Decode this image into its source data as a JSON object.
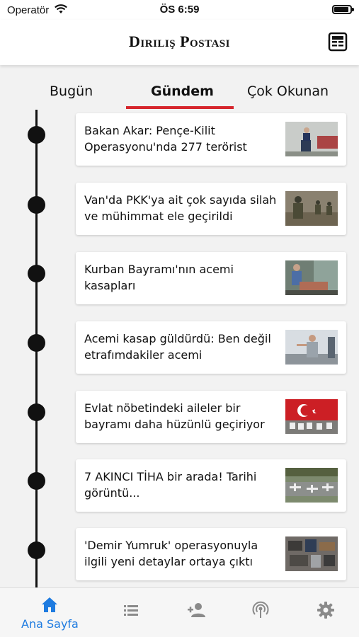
{
  "status_bar": {
    "carrier": "Operatör",
    "time": "ÖS 6:59",
    "battery_level": 0.9
  },
  "header": {
    "logo": "Diriliş Postası",
    "archive_icon": "newspaper-icon"
  },
  "tabs": [
    {
      "label": "Bugün",
      "active": false
    },
    {
      "label": "Gündem",
      "active": true
    },
    {
      "label": "Çok Okunan",
      "active": false
    }
  ],
  "accent_color": "#d6262d",
  "active_tab_color": "#1e7be0",
  "news": [
    {
      "title": "Bakan Akar: Pençe-Kilit Operasyonu'nda 277 terörist",
      "thumb": "minister-podium-photo"
    },
    {
      "title": "Van'da PKK'ya ait çok sayıda silah ve mühimmat ele geçirildi",
      "thumb": "soldiers-photo"
    },
    {
      "title": "Kurban Bayramı'nın acemi kasapları",
      "thumb": "butchers-photo"
    },
    {
      "title": "Acemi kasap güldürdü: Ben değil etrafımdakiler acemi",
      "thumb": "man-speaking-photo"
    },
    {
      "title": "Evlat nöbetindeki aileler bir bayramı daha hüzünlü geçiriyor",
      "thumb": "turkish-flag-protest-photo"
    },
    {
      "title": "7 AKINCI TİHA bir arada! Tarihi görüntü...",
      "thumb": "drones-runway-photo"
    },
    {
      "title": "'Demir Yumruk' operasyonuyla ilgili yeni detaylar ortaya çıktı",
      "thumb": "seized-items-photo"
    }
  ],
  "bottom_tabs": [
    {
      "icon": "home-icon",
      "label": "Ana Sayfa",
      "active": true
    },
    {
      "icon": "list-icon",
      "label": "",
      "active": false
    },
    {
      "icon": "add-user-icon",
      "label": "",
      "active": false
    },
    {
      "icon": "broadcast-icon",
      "label": "",
      "active": false
    },
    {
      "icon": "settings-gear-icon",
      "label": "",
      "active": false
    }
  ]
}
